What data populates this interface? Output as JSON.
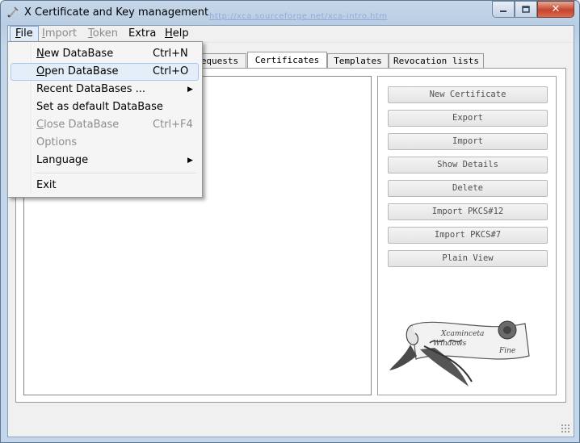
{
  "window": {
    "title": "X Certificate and Key management",
    "faint_link": "http://xca.sourceforge.net/xca-intro.htm",
    "caption_close": "✕"
  },
  "menubar": {
    "items": [
      {
        "label": "File",
        "mnemonic": "F",
        "rest": "ile"
      },
      {
        "label": "Import",
        "mnemonic": "I",
        "rest": "mport"
      },
      {
        "label": "Token",
        "mnemonic": "T",
        "rest": "oken"
      },
      {
        "label": "Extra",
        "mnemonic": "",
        "rest": "Extra"
      },
      {
        "label": "Help",
        "mnemonic": "H",
        "rest": "elp"
      }
    ]
  },
  "file_menu": {
    "items": [
      {
        "label": "New DataBase",
        "mn": "N",
        "rest": "ew DataBase",
        "shortcut": "Ctrl+N"
      },
      {
        "label": "Open DataBase",
        "mn": "O",
        "rest": "pen DataBase",
        "shortcut": "Ctrl+O"
      },
      {
        "label": "Recent DataBases ...",
        "mn": "",
        "rest": "Recent DataBases ...",
        "submenu_arrow": "▶"
      },
      {
        "label": "Set as default DataBase",
        "mn": "",
        "rest": "Set as default DataBase"
      },
      {
        "label": "Close DataBase",
        "mn": "C",
        "rest": "lose DataBase",
        "shortcut": "Ctrl+F4"
      },
      {
        "label": "Options",
        "mn": "",
        "rest": "Options"
      },
      {
        "label": "Language",
        "mn": "",
        "rest": "Language",
        "submenu_arrow": "▶"
      },
      {
        "label": "Exit",
        "mn": "",
        "rest": "Exit"
      }
    ]
  },
  "tabs": [
    {
      "label": "equests"
    },
    {
      "label": "Certificates"
    },
    {
      "label": "Templates"
    },
    {
      "label": "Revocation lists"
    }
  ],
  "buttons": [
    {
      "label": "New Certificate"
    },
    {
      "label": "Export"
    },
    {
      "label": "Import"
    },
    {
      "label": "Show Details"
    },
    {
      "label": "Delete"
    },
    {
      "label": "Import PKCS#12"
    },
    {
      "label": "Import PKCS#7"
    },
    {
      "label": "Plain View"
    }
  ],
  "logo": {
    "text_line1": "Xcaminceta",
    "text_line2": "Windows",
    "text_line3": "Fine"
  },
  "colors": {
    "accent": "#7ea5d3",
    "title_bar": "#b9cde3",
    "close_button": "#c5442d"
  }
}
